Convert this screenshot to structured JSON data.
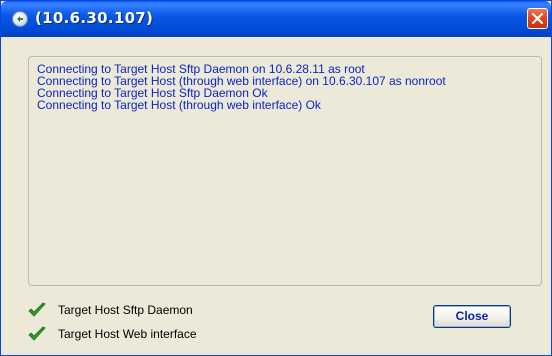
{
  "window": {
    "title": "(10.6.30.107)",
    "icon": "app-globe-icon",
    "close_icon": "close-x-icon"
  },
  "log": {
    "lines": [
      "Connecting to Target Host Sftp Daemon on 10.6.28.11 as root",
      "Connecting to Target Host (through web interface) on 10.6.30.107 as nonroot",
      "Connecting to Target Host Sftp Daemon Ok",
      "Connecting to Target Host (through web interface) Ok"
    ],
    "text_color": "#0a24c8"
  },
  "status": {
    "items": [
      {
        "label": "Target Host Sftp Daemon",
        "icon": "checkmark-icon",
        "state": "ok"
      },
      {
        "label": "Target Host Web interface",
        "icon": "checkmark-icon",
        "state": "ok"
      }
    ],
    "check_color": "#2e9a2a"
  },
  "buttons": {
    "close_label": "Close"
  },
  "colors": {
    "titlebar": "#0049d2",
    "dialog_bg": "#ece9d8",
    "close_x": "#e2461f"
  }
}
